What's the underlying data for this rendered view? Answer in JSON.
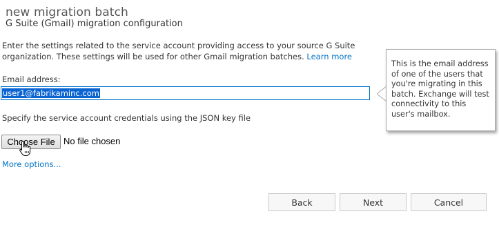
{
  "header": {
    "title": "new migration batch",
    "subtitle": "G Suite (Gmail) migration configuration"
  },
  "intro": {
    "text": "Enter the settings related to the service account providing access to your source G Suite organization. These settings will be used for other Gmail migration batches.",
    "learn_more": "Learn more"
  },
  "email": {
    "label": "Email address:",
    "value": "user1@fabrikaminc.com"
  },
  "credentials": {
    "instruction": "Specify the service account credentials using the JSON key file",
    "choose_file_label": "Choose File",
    "no_file_text": "No file chosen"
  },
  "more_options": "More options...",
  "tooltip": {
    "text": "This is the email address of one of the users that you're migrating in this batch. Exchange will test connectivity to this user's mailbox."
  },
  "footer": {
    "back_label": "Back",
    "next_label": "Next",
    "cancel_label": "Cancel"
  },
  "colors": {
    "accent": "#0072c6",
    "selection": "#0a64d2"
  },
  "icons": {
    "cursor": "hand-pointer-icon"
  }
}
